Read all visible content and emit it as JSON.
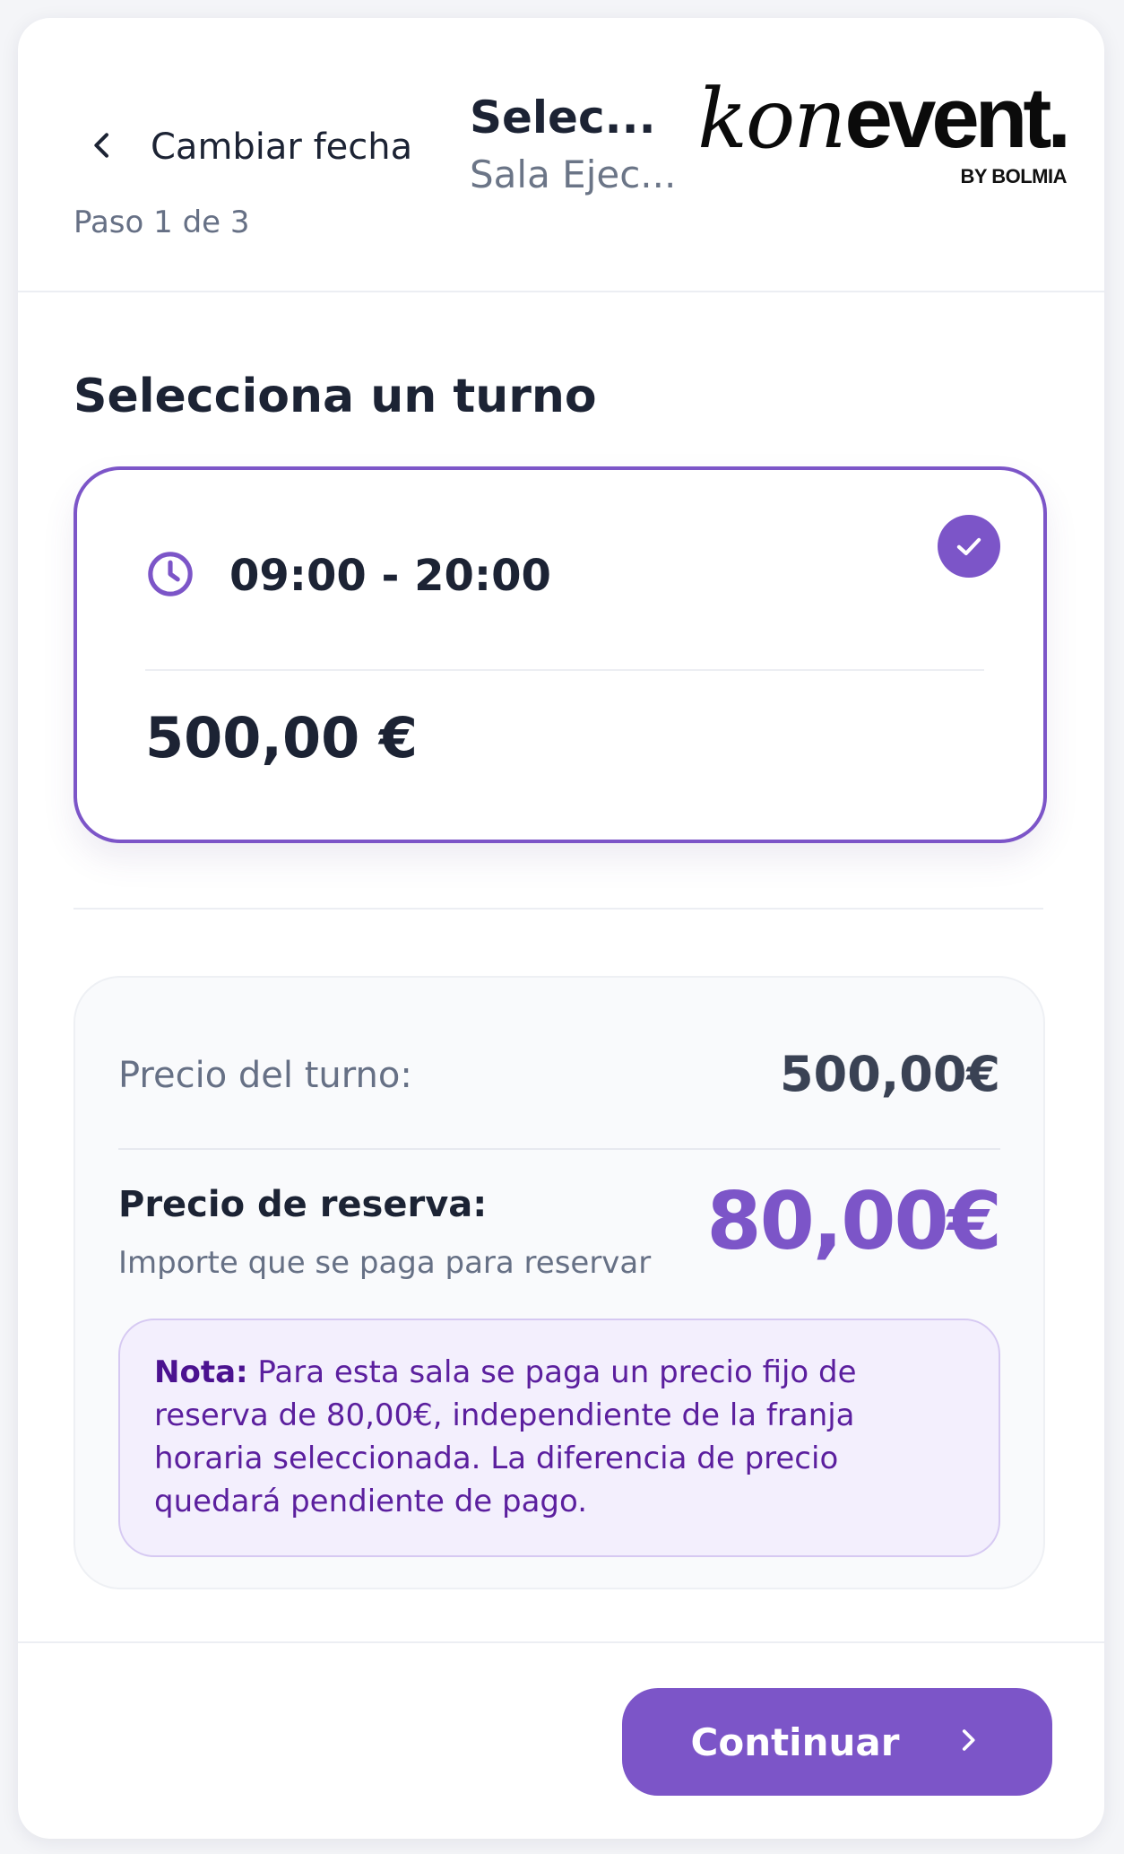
{
  "header": {
    "back_label": "Cambiar fecha",
    "step": "Paso 1 de 3",
    "title": "Selec...",
    "subtitle": "Sala Ejec...",
    "back_icon": "chevron-left-icon"
  },
  "logo": {
    "kon": "kon",
    "event": "event.",
    "byline": "BY BOLMIA"
  },
  "main": {
    "section_title": "Selecciona un turno",
    "slots": [
      {
        "time": "09:00 - 20:00",
        "price": "500,00 €",
        "selected": true,
        "icon": "clock-icon"
      }
    ]
  },
  "summary": {
    "shift_price_label": "Precio del turno:",
    "shift_price_value": "500,00€",
    "booking_price_label": "Precio de reserva:",
    "booking_price_sub": "Importe que se paga para reservar",
    "booking_price_value": "80,00€",
    "note_title": "Nota:",
    "note_text": "Para esta sala se paga un precio fijo de reserva de 80,00€, independiente de la franja horaria seleccionada. La diferencia de precio quedará pendiente de pago."
  },
  "footer": {
    "continue_label": "Continuar",
    "continue_icon": "chevron-right-icon"
  },
  "colors": {
    "accent": "#7c55c8",
    "text": "#1c2334",
    "muted": "#667085",
    "note_bg": "#f3effd",
    "note_text": "#5b1f9e"
  }
}
